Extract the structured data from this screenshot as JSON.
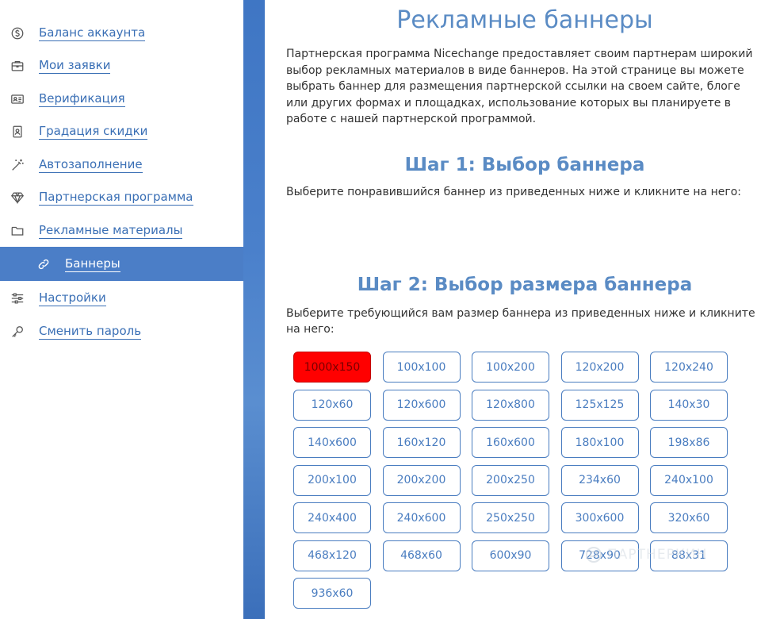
{
  "sidebar": {
    "items": [
      {
        "label": "Баланс аккаунта",
        "icon": "coin-icon"
      },
      {
        "label": "Мои заявки",
        "icon": "briefcase-icon"
      },
      {
        "label": "Верификация",
        "icon": "id-card-icon"
      },
      {
        "label": "Градация скидки",
        "icon": "badge-icon"
      },
      {
        "label": "Автозаполнение",
        "icon": "magic-wand-icon"
      },
      {
        "label": "Партнерская программа",
        "icon": "diamond-icon"
      },
      {
        "label": "Рекламные материалы",
        "icon": "folder-icon"
      },
      {
        "label": "Баннеры",
        "icon": "link-icon",
        "active": true
      },
      {
        "label": "Настройки",
        "icon": "sliders-icon"
      },
      {
        "label": "Сменить пароль",
        "icon": "key-icon"
      }
    ]
  },
  "main": {
    "title": "Рекламные баннеры",
    "intro": "Партнерская программа Nicechange предоставляет своим партнерам широкий выбор рекламных материалов в виде баннеров. На этой странице вы можете выбрать баннер для размещения партнерской ссылки на своем сайте, блоге или других формах и площадках, использование которых вы планируете в работе с нашей партнерской программой.",
    "step1": {
      "title": "Шаг 1: Выбор баннера",
      "text": "Выберите понравившийся баннер из приведенных ниже и кликните на него:"
    },
    "step2": {
      "title": "Шаг 2: Выбор размера баннера",
      "text": "Выберите требующийся вам размер баннера из приведенных ниже и кликните на него:",
      "sizes": [
        "1000x150",
        "100x100",
        "100x200",
        "120x200",
        "120x240",
        "120x60",
        "120x600",
        "120x800",
        "125x125",
        "140x30",
        "140x600",
        "160x120",
        "160x600",
        "180x100",
        "198x86",
        "200x100",
        "200x200",
        "200x250",
        "234x60",
        "240x100",
        "240x400",
        "240x600",
        "250x250",
        "300x600",
        "320x60",
        "468x120",
        "468x60",
        "600x90",
        "728x90",
        "88x31",
        "936x60"
      ],
      "selected": "1000x150"
    }
  },
  "watermark": {
    "text": "ПАРТНЕРКИН"
  },
  "colors": {
    "accent": "#4b7ec7",
    "selected": "#ff0000",
    "link": "#3a6fb5"
  }
}
